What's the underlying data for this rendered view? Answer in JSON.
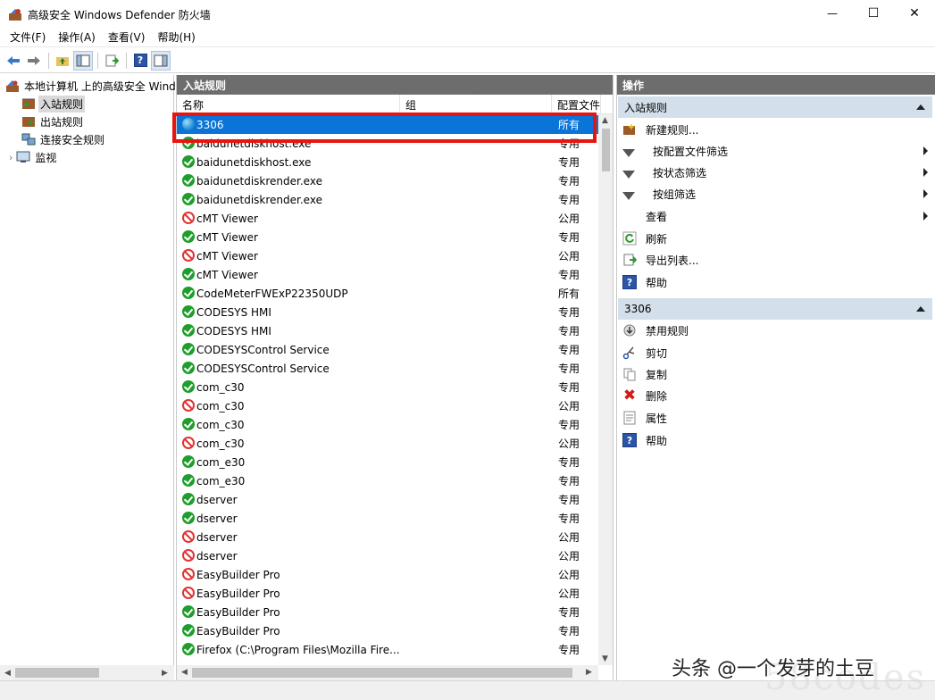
{
  "window": {
    "title": "高级安全 Windows Defender 防火墙",
    "minimize": "—",
    "maximize": "☐",
    "close": "✕"
  },
  "menu": [
    "文件(F)",
    "操作(A)",
    "查看(V)",
    "帮助(H)"
  ],
  "tree": {
    "root": "本地计算机 上的高级安全 Windows",
    "items": [
      {
        "label": "入站规则",
        "selected": true
      },
      {
        "label": "出站规则",
        "selected": false
      },
      {
        "label": "连接安全规则",
        "selected": false
      },
      {
        "label": "监视",
        "selected": false
      }
    ]
  },
  "center": {
    "title": "入站规则",
    "columns": [
      "名称",
      "组",
      "配置文件"
    ],
    "rows": [
      {
        "name": "3306",
        "profile": "所有",
        "status": "globe"
      },
      {
        "name": "baidunetdiskhost.exe",
        "profile": "专用",
        "status": "allow"
      },
      {
        "name": "baidunetdiskhost.exe",
        "profile": "专用",
        "status": "allow"
      },
      {
        "name": "baidunetdiskrender.exe",
        "profile": "专用",
        "status": "allow"
      },
      {
        "name": "baidunetdiskrender.exe",
        "profile": "专用",
        "status": "allow"
      },
      {
        "name": "cMT Viewer",
        "profile": "公用",
        "status": "block"
      },
      {
        "name": "cMT Viewer",
        "profile": "专用",
        "status": "allow"
      },
      {
        "name": "cMT Viewer",
        "profile": "公用",
        "status": "block"
      },
      {
        "name": "cMT Viewer",
        "profile": "专用",
        "status": "allow"
      },
      {
        "name": "CodeMeterFWExP22350UDP",
        "profile": "所有",
        "status": "allow"
      },
      {
        "name": "CODESYS HMI",
        "profile": "专用",
        "status": "allow"
      },
      {
        "name": "CODESYS HMI",
        "profile": "专用",
        "status": "allow"
      },
      {
        "name": "CODESYSControl Service",
        "profile": "专用",
        "status": "allow"
      },
      {
        "name": "CODESYSControl Service",
        "profile": "专用",
        "status": "allow"
      },
      {
        "name": "com_c30",
        "profile": "专用",
        "status": "allow"
      },
      {
        "name": "com_c30",
        "profile": "公用",
        "status": "block"
      },
      {
        "name": "com_c30",
        "profile": "专用",
        "status": "allow"
      },
      {
        "name": "com_c30",
        "profile": "公用",
        "status": "block"
      },
      {
        "name": "com_e30",
        "profile": "专用",
        "status": "allow"
      },
      {
        "name": "com_e30",
        "profile": "专用",
        "status": "allow"
      },
      {
        "name": "dserver",
        "profile": "专用",
        "status": "allow"
      },
      {
        "name": "dserver",
        "profile": "专用",
        "status": "allow"
      },
      {
        "name": "dserver",
        "profile": "公用",
        "status": "block"
      },
      {
        "name": "dserver",
        "profile": "公用",
        "status": "block"
      },
      {
        "name": "EasyBuilder Pro",
        "profile": "公用",
        "status": "block"
      },
      {
        "name": "EasyBuilder Pro",
        "profile": "公用",
        "status": "block"
      },
      {
        "name": "EasyBuilder Pro",
        "profile": "专用",
        "status": "allow"
      },
      {
        "name": "EasyBuilder Pro",
        "profile": "专用",
        "status": "allow"
      },
      {
        "name": "Firefox (C:\\Program Files\\Mozilla Fire...",
        "profile": "专用",
        "status": "allow"
      }
    ]
  },
  "actions": {
    "title": "操作",
    "section1": {
      "title": "入站规则",
      "items": [
        {
          "label": "新建规则...",
          "icon": "new-rule-icon",
          "submenu": false
        },
        {
          "label": "按配置文件筛选",
          "icon": "filter-icon",
          "submenu": true
        },
        {
          "label": "按状态筛选",
          "icon": "filter-icon",
          "submenu": true
        },
        {
          "label": "按组筛选",
          "icon": "filter-icon",
          "submenu": true
        },
        {
          "label": "查看",
          "icon": "",
          "submenu": true
        },
        {
          "label": "刷新",
          "icon": "refresh-icon",
          "submenu": false
        },
        {
          "label": "导出列表...",
          "icon": "export-icon",
          "submenu": false
        },
        {
          "label": "帮助",
          "icon": "help-icon",
          "submenu": false
        }
      ]
    },
    "section2": {
      "title": "3306",
      "items": [
        {
          "label": "禁用规则",
          "icon": "disable-icon"
        },
        {
          "label": "剪切",
          "icon": "cut-icon"
        },
        {
          "label": "复制",
          "icon": "copy-icon"
        },
        {
          "label": "删除",
          "icon": "delete-icon"
        },
        {
          "label": "属性",
          "icon": "properties-icon"
        },
        {
          "label": "帮助",
          "icon": "help-icon"
        }
      ]
    }
  },
  "watermark": {
    "text": "头条 @一个发芽的土豆",
    "logo": "58codes"
  },
  "colors": {
    "selected_row": "#0a74d8",
    "pane_header": "#6d6d6d",
    "section_header": "#d3dfea",
    "highlight_box": "#e8140f"
  }
}
